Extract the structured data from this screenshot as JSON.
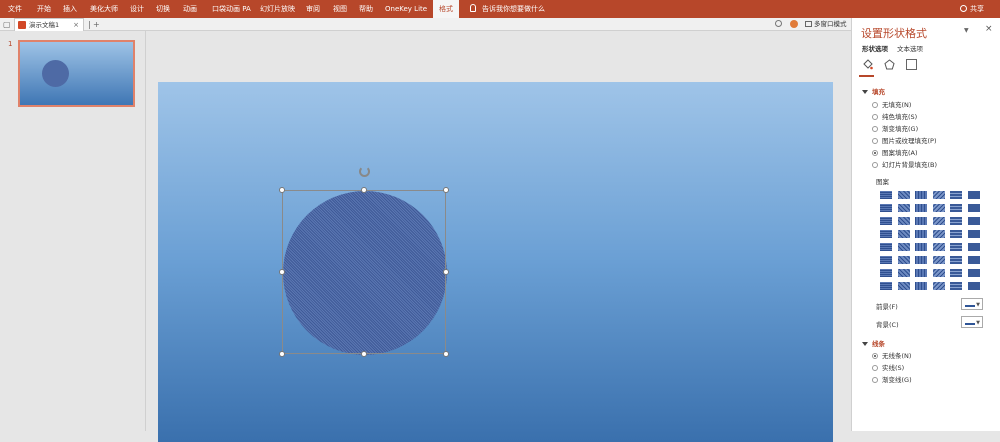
{
  "ribbon": {
    "tabs": [
      {
        "label": "文件"
      },
      {
        "label": "开始"
      },
      {
        "label": "插入"
      },
      {
        "label": "美化大师"
      },
      {
        "label": "设计"
      },
      {
        "label": "切换"
      },
      {
        "label": "动画"
      },
      {
        "label": "口袋动画 PA"
      },
      {
        "label": "幻灯片放映"
      },
      {
        "label": "审阅"
      },
      {
        "label": "视图"
      },
      {
        "label": "帮助"
      },
      {
        "label": "OneKey Lite"
      },
      {
        "label": "格式"
      }
    ],
    "active_tab": "格式",
    "tell_me": "告诉我你想要做什么",
    "share": "共享"
  },
  "document": {
    "tab_name": "演示文稿1",
    "close_glyph": "×",
    "new_tab_glyph": "+",
    "multi_window": "多窗口模式"
  },
  "thumbnails": {
    "slide_number": "1"
  },
  "panel": {
    "title": "设置形状格式",
    "dropdown_glyph": "▼",
    "close_glyph": "×",
    "tabs": [
      "形状选项",
      "文本选项"
    ],
    "fill": {
      "heading": "填充",
      "options": [
        "无填充(N)",
        "纯色填充(S)",
        "渐变填充(G)",
        "图片或纹理填充(P)",
        "图案填充(A)",
        "幻灯片背景填充(B)"
      ],
      "selected_index": 4,
      "pattern_label": "图案",
      "foreground_label": "前景(F)",
      "background_label": "背景(C)"
    },
    "line": {
      "heading": "线条",
      "options": [
        "无线条(N)",
        "实线(S)",
        "渐变线(G)"
      ],
      "selected_index": 0
    }
  },
  "colors": {
    "ribbon": "#b7472a",
    "accent": "#b7472a",
    "pattern_fill": "#3f5a98"
  }
}
